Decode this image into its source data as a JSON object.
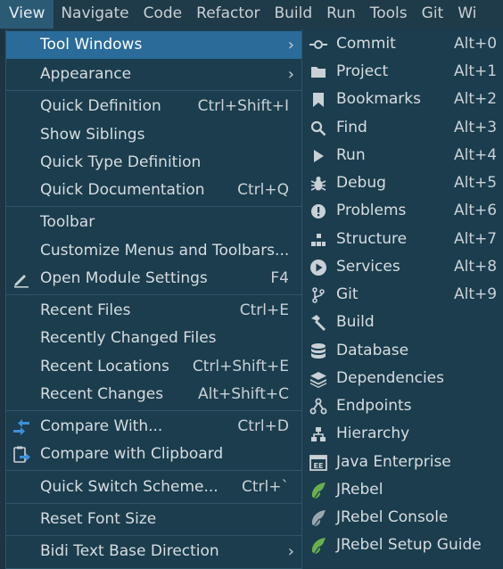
{
  "menubar": {
    "items": [
      "View",
      "Navigate",
      "Code",
      "Refactor",
      "Build",
      "Run",
      "Tools",
      "Git",
      "Wi"
    ]
  },
  "view_menu": {
    "items": [
      {
        "label": "Tool Windows",
        "shortcut": "",
        "submenu": true,
        "icon": "",
        "highlighted": true
      },
      {
        "label": "Appearance",
        "shortcut": "",
        "submenu": true,
        "icon": ""
      },
      {
        "label": "Quick Definition",
        "shortcut": "Ctrl+Shift+I",
        "icon": ""
      },
      {
        "label": "Show Siblings",
        "shortcut": "",
        "icon": ""
      },
      {
        "label": "Quick Type Definition",
        "shortcut": "",
        "icon": ""
      },
      {
        "label": "Quick Documentation",
        "shortcut": "Ctrl+Q",
        "icon": ""
      },
      {
        "label": "Toolbar",
        "shortcut": "",
        "icon": ""
      },
      {
        "label": "Customize Menus and Toolbars...",
        "shortcut": "",
        "icon": ""
      },
      {
        "label": "Open Module Settings",
        "shortcut": "F4",
        "icon": "edit-icon"
      },
      {
        "label": "Recent Files",
        "shortcut": "Ctrl+E",
        "icon": ""
      },
      {
        "label": "Recently Changed Files",
        "shortcut": "",
        "icon": ""
      },
      {
        "label": "Recent Locations",
        "shortcut": "Ctrl+Shift+E",
        "icon": ""
      },
      {
        "label": "Recent Changes",
        "shortcut": "Alt+Shift+C",
        "icon": ""
      },
      {
        "label": "Compare With...",
        "shortcut": "Ctrl+D",
        "icon": "compare-icon"
      },
      {
        "label": "Compare with Clipboard",
        "shortcut": "",
        "icon": "compare-clipboard-icon"
      },
      {
        "label": "Quick Switch Scheme...",
        "shortcut": "Ctrl+`",
        "icon": ""
      },
      {
        "label": "Reset Font Size",
        "shortcut": "",
        "icon": ""
      },
      {
        "label": "Bidi Text Base Direction",
        "shortcut": "",
        "submenu": true,
        "icon": ""
      }
    ]
  },
  "tool_windows_submenu": {
    "items": [
      {
        "label": "Commit",
        "shortcut": "Alt+0",
        "icon": "commit-icon"
      },
      {
        "label": "Project",
        "shortcut": "Alt+1",
        "icon": "folder-icon"
      },
      {
        "label": "Bookmarks",
        "shortcut": "Alt+2",
        "icon": "bookmark-icon"
      },
      {
        "label": "Find",
        "shortcut": "Alt+3",
        "icon": "search-icon"
      },
      {
        "label": "Run",
        "shortcut": "Alt+4",
        "icon": "run-icon"
      },
      {
        "label": "Debug",
        "shortcut": "Alt+5",
        "icon": "bug-icon"
      },
      {
        "label": "Problems",
        "shortcut": "Alt+6",
        "icon": "problems-icon"
      },
      {
        "label": "Structure",
        "shortcut": "Alt+7",
        "icon": "structure-icon"
      },
      {
        "label": "Services",
        "shortcut": "Alt+8",
        "icon": "services-icon"
      },
      {
        "label": "Git",
        "shortcut": "Alt+9",
        "icon": "git-branch-icon"
      },
      {
        "label": "Build",
        "shortcut": "",
        "icon": "hammer-icon"
      },
      {
        "label": "Database",
        "shortcut": "",
        "icon": "database-icon"
      },
      {
        "label": "Dependencies",
        "shortcut": "",
        "icon": "dependencies-icon"
      },
      {
        "label": "Endpoints",
        "shortcut": "",
        "icon": "endpoints-icon"
      },
      {
        "label": "Hierarchy",
        "shortcut": "",
        "icon": "hierarchy-icon"
      },
      {
        "label": "Java Enterprise",
        "shortcut": "",
        "icon": "java-enterprise-icon"
      },
      {
        "label": "JRebel",
        "shortcut": "",
        "icon": "jrebel-icon"
      },
      {
        "label": "JRebel Console",
        "shortcut": "",
        "icon": "jrebel-console-icon"
      },
      {
        "label": "JRebel Setup Guide",
        "shortcut": "",
        "icon": "jrebel-setup-icon"
      }
    ]
  },
  "colors": {
    "menubar_bg": "#1f3a48",
    "menu_bg": "#1b3d4e",
    "highlight": "#2a6b9a",
    "text": "#d7dde1",
    "jrebel_green": "#6ab04c"
  }
}
